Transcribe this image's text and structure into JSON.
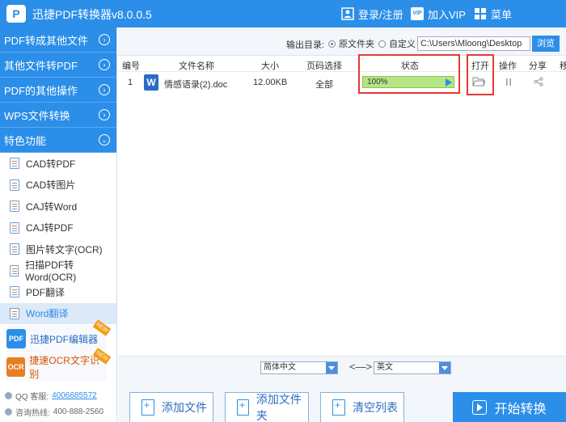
{
  "app": {
    "logo_letter": "P",
    "title": "迅捷PDF转换器v8.0.0.5",
    "accent": "#2b8ee8",
    "highlight": "#e53935"
  },
  "titlebar": {
    "login": "登录/注册",
    "vip": "加入VIP",
    "menu": "菜单",
    "vip_badge": "VIP"
  },
  "sidebar": {
    "categories": [
      {
        "label": "PDF转成其他文件",
        "icon": "chevron-right-circle-icon"
      },
      {
        "label": "其他文件转PDF",
        "icon": "chevron-right-circle-icon"
      },
      {
        "label": "PDF的其他操作",
        "icon": "chevron-right-circle-icon"
      },
      {
        "label": "WPS文件转换",
        "icon": "chevron-right-circle-icon"
      },
      {
        "label": "特色功能",
        "icon": "chevron-down-circle-icon"
      }
    ],
    "features": [
      {
        "label": "CAD转PDF"
      },
      {
        "label": "CAD转图片"
      },
      {
        "label": "CAJ转Word"
      },
      {
        "label": "CAJ转PDF"
      },
      {
        "label": "图片转文字(OCR)"
      },
      {
        "label": "扫描PDF转Word(OCR)"
      },
      {
        "label": "PDF翻译"
      },
      {
        "label": "Word翻译",
        "active": true
      }
    ],
    "promos": [
      {
        "label": "迅捷PDF编辑器",
        "pic": "PDF",
        "tag": "NEW"
      },
      {
        "label": "捷速OCR文字识别",
        "pic": "OCR",
        "tag": "NEW"
      }
    ],
    "qq_label": "QQ 客服:",
    "qq_number": "4006685572",
    "phone_label": "咨询热线:",
    "phone_number": "400-888-2560"
  },
  "output": {
    "label": "输出目录:",
    "options": [
      {
        "label": "原文件夹",
        "selected": true
      },
      {
        "label": "自定义",
        "selected": false
      }
    ],
    "path": "C:\\Users\\Mloong\\Desktop",
    "browse": "浏览"
  },
  "table": {
    "headers": [
      "编号",
      "文件名称",
      "大小",
      "页码选择",
      "状态",
      "打开",
      "操作",
      "分享",
      "移"
    ],
    "rows": [
      {
        "num": "1",
        "icon_letter": "W",
        "name": "情感语录(2).doc",
        "size": "12.00KB",
        "pages": "全部",
        "progress_text": "100%",
        "progress": 1.0
      }
    ]
  },
  "lang": {
    "source": "简体中文",
    "swap": "<—>",
    "target": "英文"
  },
  "buttons": {
    "add_file": "添加文件",
    "add_folder": "添加文件夹",
    "clear": "清空列表",
    "start": "开始转换"
  }
}
